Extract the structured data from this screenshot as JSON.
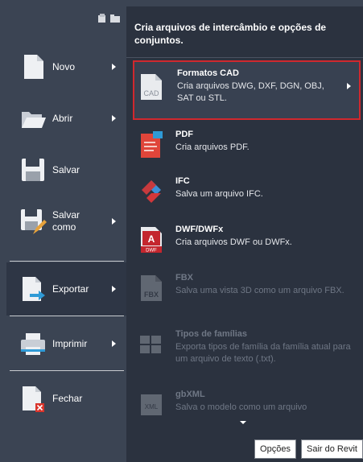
{
  "header": "Cria arquivos de intercâmbio e opções de conjuntos.",
  "left_items": [
    {
      "label": "Novo",
      "icon": "new-file-icon"
    },
    {
      "label": "Abrir",
      "icon": "open-folder-icon"
    },
    {
      "label": "Salvar",
      "icon": "save-disk-icon"
    },
    {
      "label": "Salvar\ncomo",
      "icon": "save-as-icon"
    },
    {
      "label": "Exportar",
      "icon": "export-icon"
    },
    {
      "label": "Imprimir",
      "icon": "printer-icon"
    },
    {
      "label": "Fechar",
      "icon": "close-file-icon"
    }
  ],
  "export_options": [
    {
      "title": "Formatos CAD",
      "desc": "Cria arquivos DWG, DXF, DGN, OBJ, SAT ou STL.",
      "icon": "cad-file-icon",
      "icon_text": "CAD"
    },
    {
      "title": "PDF",
      "desc": "Cria arquivos PDF.",
      "icon": "pdf-icon"
    },
    {
      "title": "IFC",
      "desc": "Salva um arquivo IFC.",
      "icon": "ifc-icon"
    },
    {
      "title": "DWF/DWFx",
      "desc": "Cria arquivos DWF ou DWFx.",
      "icon": "dwf-icon",
      "icon_text": "DWF"
    },
    {
      "title": "FBX",
      "desc": "Salva uma vista 3D como um arquivo FBX.",
      "icon": "fbx-icon",
      "icon_text": "FBX"
    },
    {
      "title": "Tipos de famílias",
      "desc": "Exporta tipos de família da família atual para um arquivo de texto (.txt).",
      "icon": "family-types-icon"
    },
    {
      "title": "gbXML",
      "desc": "Salva o modelo como um arquivo",
      "icon": "gbxml-icon",
      "icon_text": "XML"
    }
  ],
  "buttons": {
    "options": "Opções",
    "exit": "Sair do Revit"
  },
  "colors": {
    "selected_border": "#d0282e",
    "pdf_red": "#e0453a",
    "dwf_red": "#c4262e"
  }
}
